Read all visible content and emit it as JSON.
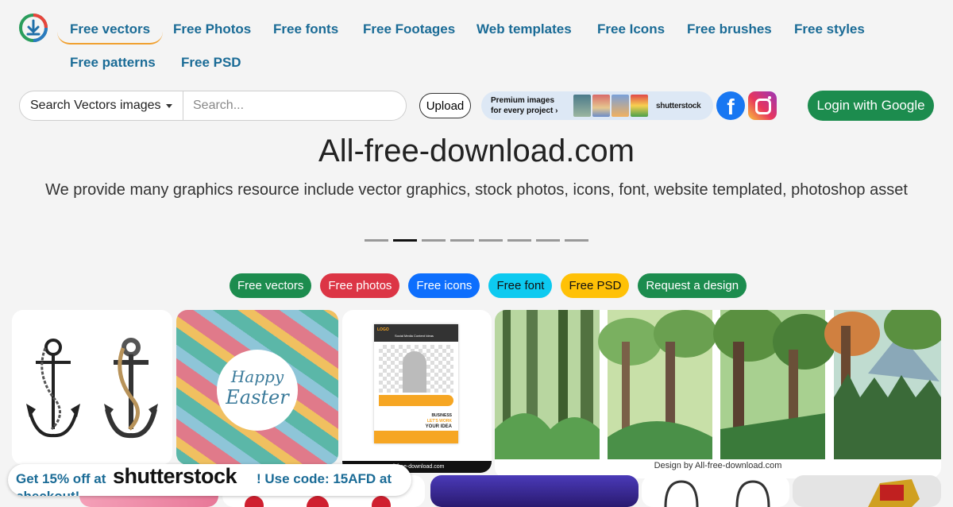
{
  "nav": {
    "items": [
      {
        "label": "Free vectors",
        "active": true
      },
      {
        "label": "Free Photos"
      },
      {
        "label": "Free fonts"
      },
      {
        "label": "Free Footages"
      },
      {
        "label": "Web templates"
      },
      {
        "label": "Free Icons"
      },
      {
        "label": "Free brushes"
      },
      {
        "label": "Free styles"
      },
      {
        "label": "Free patterns"
      },
      {
        "label": "Free PSD"
      }
    ]
  },
  "search": {
    "category": "Search Vectors images",
    "placeholder": "Search...",
    "upload_label": "Upload"
  },
  "promo": {
    "line1": "Premium images",
    "line2": "for every project",
    "arrow": "›",
    "brand": "shutterstock"
  },
  "social": {
    "facebook_glyph": "f"
  },
  "login_label": "Login with Google",
  "hero": {
    "title": "All-free-download.com",
    "subtitle": "We provide many graphics resource include vector graphics, stock photos, icons, font, website templated, photoshop asset"
  },
  "carousel": {
    "count": 8,
    "active_index": 1
  },
  "pills": [
    {
      "label": "Free vectors",
      "bg": "#1c8c4e",
      "fg": "#ffffff"
    },
    {
      "label": "Free photos",
      "bg": "#dc3545",
      "fg": "#ffffff"
    },
    {
      "label": "Free icons",
      "bg": "#0d6efd",
      "fg": "#ffffff"
    },
    {
      "label": "Free font",
      "bg": "#0dcaf0",
      "fg": "#111111"
    },
    {
      "label": "Free PSD",
      "bg": "#ffc107",
      "fg": "#111111"
    },
    {
      "label": "Request a design",
      "bg": "#1c8c4e",
      "fg": "#ffffff"
    }
  ],
  "cards": {
    "easter_text1": "Happy",
    "easter_text2": "Easter",
    "flyer_logo": "LOGO",
    "flyer_head": "Social Media Content Ideas",
    "flyer_business": "BUSINESS",
    "flyer_idea1": "LET'S WORK",
    "flyer_idea2": "YOUR IDEA",
    "flyer_footer": "all-free-download.com",
    "forest_caption": "Design by All-free-download.com"
  },
  "coupon": {
    "text1": "Get 15% off at",
    "brand": "shutterstock",
    "text2": "! Use code: 15AFD at",
    "text3": "checkout!"
  }
}
